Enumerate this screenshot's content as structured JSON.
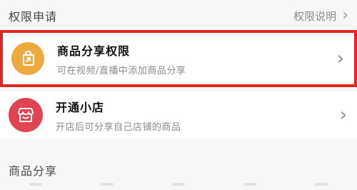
{
  "header": {
    "title": "权限申请",
    "explain_label": "权限说明"
  },
  "items": [
    {
      "title": "商品分享权限",
      "subtitle": "可在视频/直播中添加商品分享",
      "icon": "share-box-icon",
      "accent": "#ecab3c",
      "highlighted": true
    },
    {
      "title": "开通小店",
      "subtitle": "开店后可分享自己店铺的商品",
      "icon": "shop-icon",
      "accent": "#e24352",
      "highlighted": false
    }
  ],
  "section2": {
    "title": "商品分享"
  },
  "colors": {
    "highlight_border": "#e0261f",
    "background": "#f7f7f7"
  }
}
